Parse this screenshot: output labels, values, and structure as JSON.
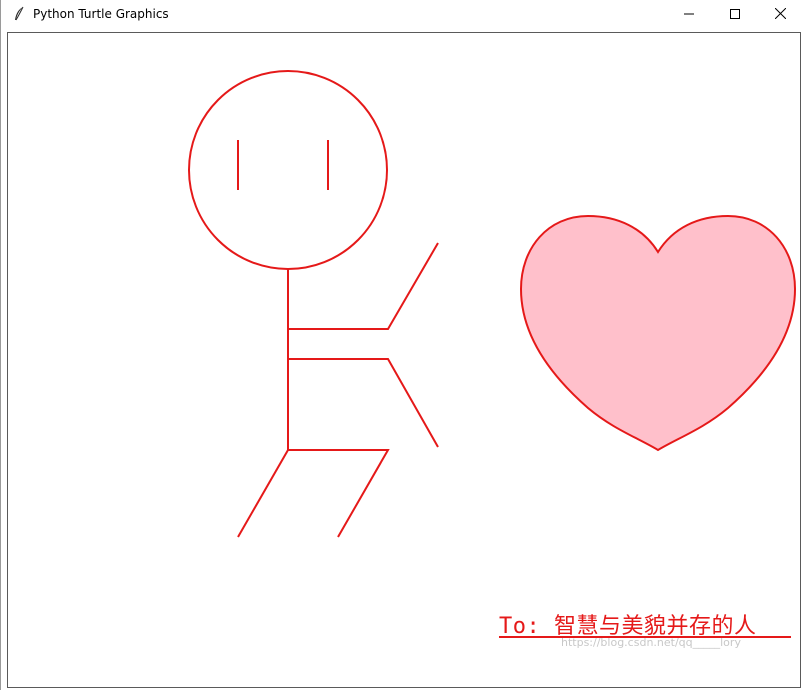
{
  "window": {
    "title": "Python Turtle Graphics",
    "icon": "feather-icon",
    "controls": {
      "minimize": "minimize-icon",
      "maximize": "maximize-icon",
      "close": "close-icon"
    }
  },
  "canvas": {
    "caption": "To: 智慧与美貌并存的人",
    "watermark": "https://blog.csdn.net/qq_____lory",
    "colors": {
      "pen": "#e51919",
      "heart_fill": "#ffc0cb",
      "background": "#ffffff"
    }
  }
}
